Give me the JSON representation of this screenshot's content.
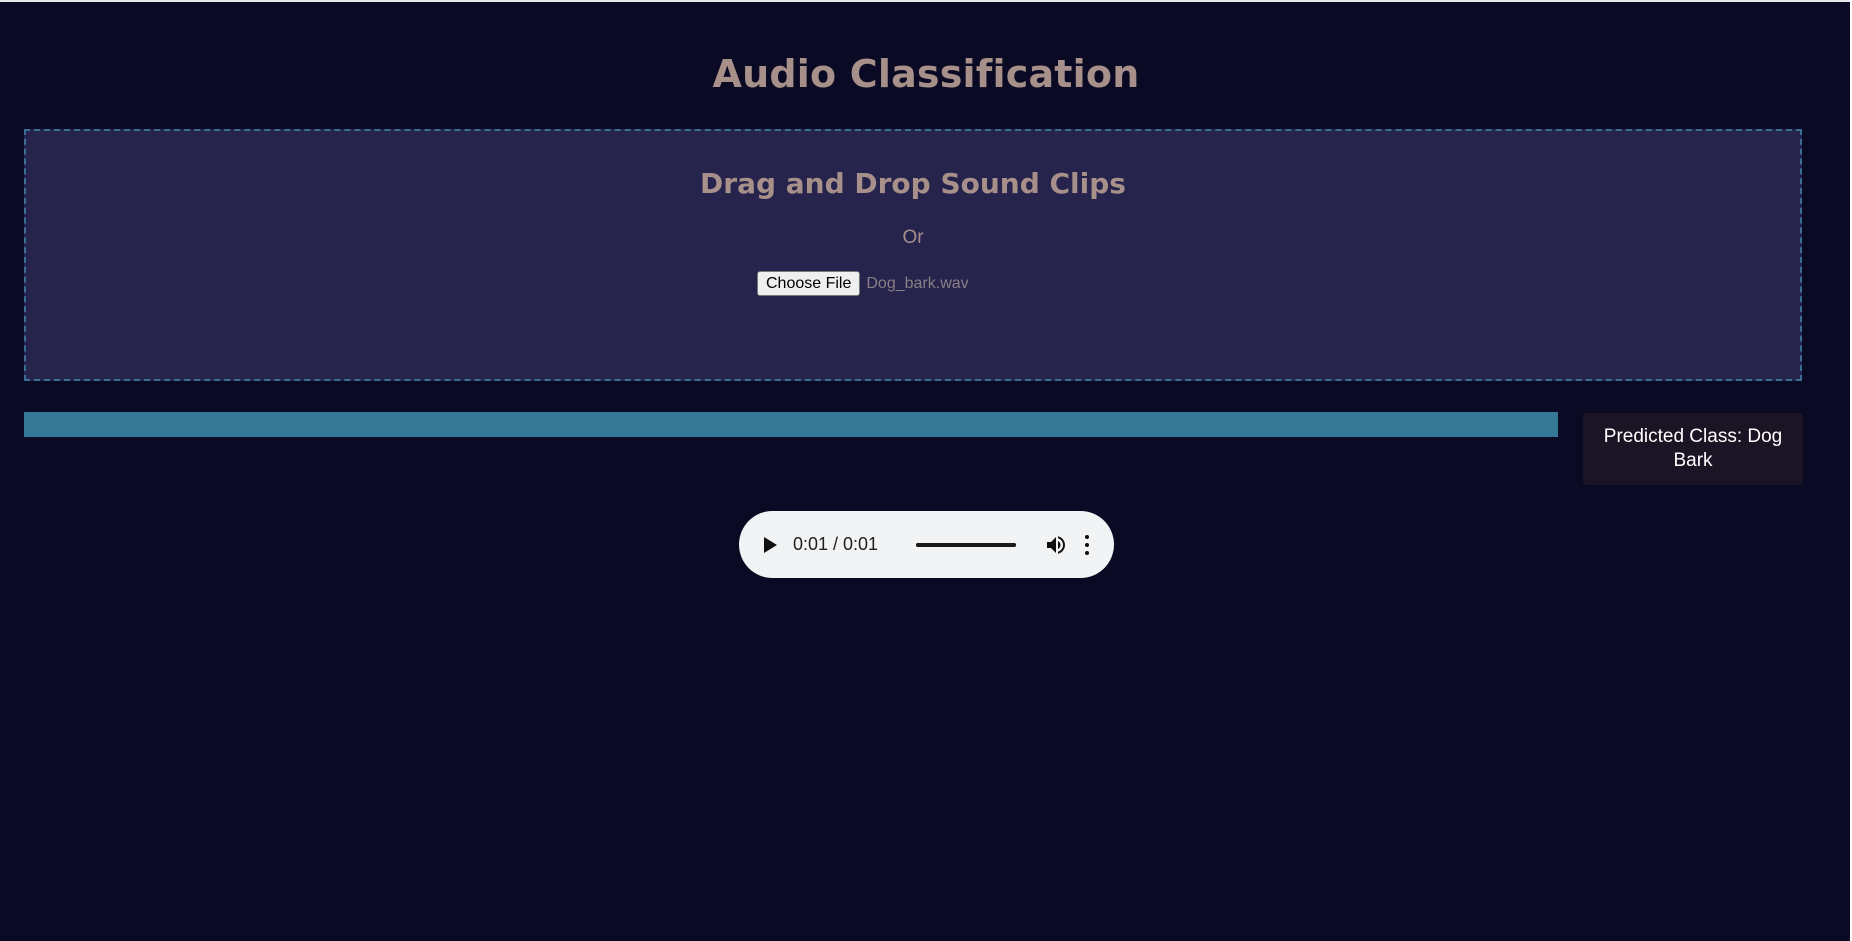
{
  "page": {
    "title": "Audio Classification"
  },
  "drop_zone": {
    "title": "Drag and Drop Sound Clips",
    "or_text": "Or",
    "choose_file_label": "Choose File",
    "file_name": "Dog_bark.wav"
  },
  "progress": {
    "value_percent": 100
  },
  "prediction": {
    "text": "Predicted Class: Dog Bark"
  },
  "audio_player": {
    "time_display": "0:01 / 0:01",
    "position_fraction": 1.0,
    "icons": [
      "play-icon",
      "volume-icon",
      "more-options-icon"
    ]
  },
  "colors": {
    "background": "#0a0a25",
    "drop_zone_background": "#26234d",
    "drop_zone_border": "#3a6f93",
    "heading_text": "#a8908a",
    "progress_fill": "#357896",
    "prediction_background": "#1b1424"
  }
}
